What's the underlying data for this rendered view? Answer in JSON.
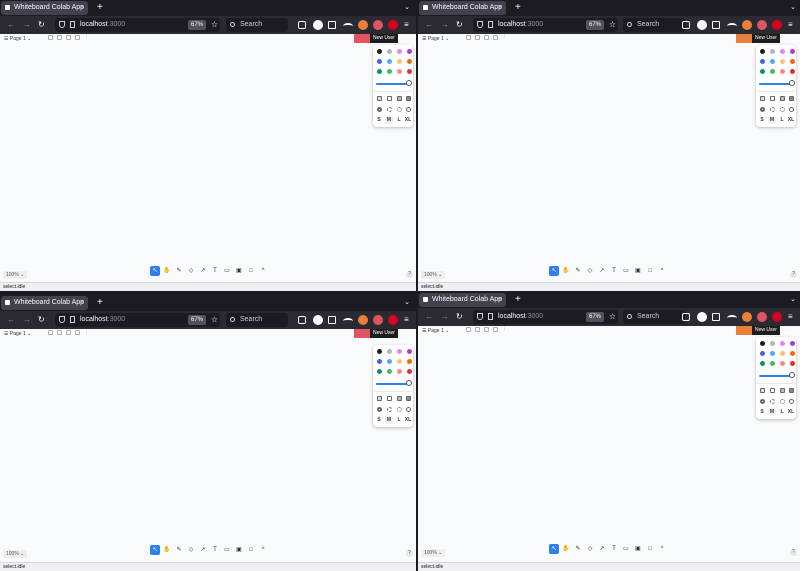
{
  "tab": {
    "title": "Whiteboard Colab App",
    "close": "×"
  },
  "new_tab": "+",
  "tab_menu": "⌄",
  "nav": {
    "back": "←",
    "forward": "→",
    "reload": "↻",
    "menu": "≡"
  },
  "url": {
    "host": "localhost",
    "port": ":3000"
  },
  "zoom_badges": [
    "67%",
    "67%",
    "67%",
    "67%"
  ],
  "search": {
    "placeholder": "Search"
  },
  "app": {
    "page_selector": "Page 1",
    "user_label": "New User",
    "zoom_level": "100%",
    "help": "?",
    "status": "select.idle",
    "toolbar_more": "^"
  },
  "user_colors": [
    "#e05561",
    "#e8803a",
    "#e05561",
    "#e8803a"
  ],
  "palette": [
    "#1d1d1d",
    "#adb5bd",
    "#e085f4",
    "#ae3ec9",
    "#4263eb",
    "#4dabf7",
    "#ffc078",
    "#f76707",
    "#099268",
    "#40c057",
    "#ff8787",
    "#e03131"
  ],
  "sizes": [
    "S",
    "M",
    "L",
    "XL"
  ],
  "tools": [
    "select",
    "hand",
    "draw",
    "eraser",
    "arrow",
    "text",
    "note",
    "media",
    "rectangle",
    "more"
  ]
}
